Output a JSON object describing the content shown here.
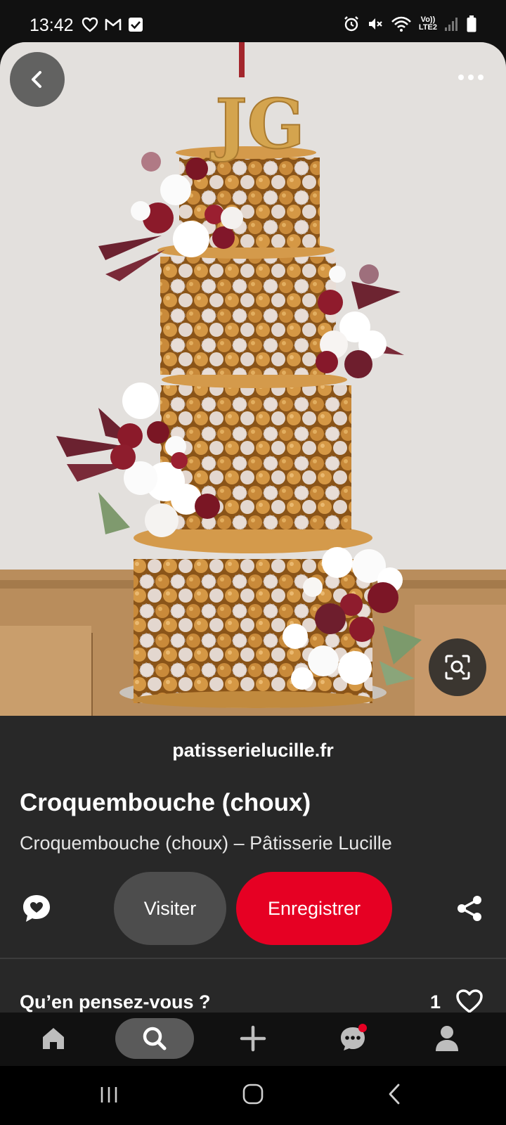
{
  "status_bar": {
    "time": "13:42",
    "left_icons": [
      "heart-icon",
      "gmail-icon",
      "checkbox-icon"
    ],
    "right_icons": [
      "alarm-icon",
      "mute-icon",
      "wifi-icon",
      "volte-icon",
      "signal-icon",
      "battery-icon"
    ],
    "volte_label": "Vo))\nLTE2"
  },
  "pin": {
    "image_subject": "croquembouche",
    "topper_letters": "JG",
    "back_icon": "chevron-left-icon",
    "more_icon": "more-horizontal-icon",
    "lens_icon": "visual-search-icon"
  },
  "detail": {
    "source": "patisserielucille.fr",
    "title": "Croquembouche (choux)",
    "description": "Croquembouche (choux) – Pâtisserie Lucille",
    "visit_label": "Visiter",
    "save_label": "Enregistrer",
    "comments_prompt": "Qu’en pensez-vous ?",
    "reaction_count": "1"
  },
  "bottom_nav": {
    "items": [
      "home-icon",
      "search-icon",
      "create-icon",
      "messages-icon",
      "profile-icon"
    ],
    "active": "search-icon"
  },
  "system_nav": [
    "recents-icon",
    "home-button-icon",
    "back-icon"
  ],
  "colors": {
    "save_red": "#e60023",
    "panel_bg": "#282828",
    "visit_grey": "#4d4d4d"
  }
}
